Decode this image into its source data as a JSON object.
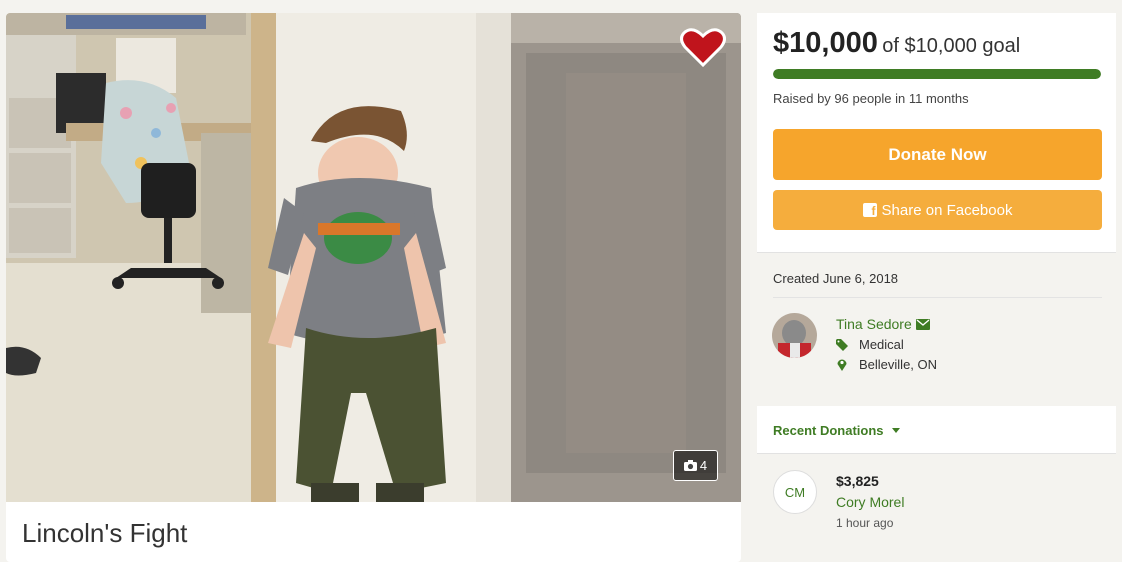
{
  "campaign": {
    "title": "Lincoln's Fight",
    "photo_count": "4"
  },
  "funding": {
    "raised": "$10,000",
    "goal_text": "of $10,000 goal",
    "progress_fraction": 1.0,
    "raised_by": "Raised by 96 people in 11 months",
    "donate_label": "Donate Now",
    "share_label": "Share on Facebook"
  },
  "organizer": {
    "created": "Created June 6, 2018",
    "name": "Tina Sedore",
    "category": "Medical",
    "location": "Belleville, ON"
  },
  "donations": {
    "header": "Recent Donations",
    "items": [
      {
        "initials": "CM",
        "amount": "$3,825",
        "name": "Cory Morel",
        "time": "1 hour ago"
      }
    ]
  },
  "colors": {
    "accent_green": "#3f7c24",
    "donate_orange": "#f6a52c",
    "heart_red": "#c0141c"
  },
  "icons": {
    "favorite": "heart-icon",
    "photos": "camera-icon",
    "share": "facebook-icon",
    "contact": "envelope-icon",
    "category": "tag-icon",
    "location": "map-pin-icon",
    "dropdown": "caret-down-icon"
  }
}
